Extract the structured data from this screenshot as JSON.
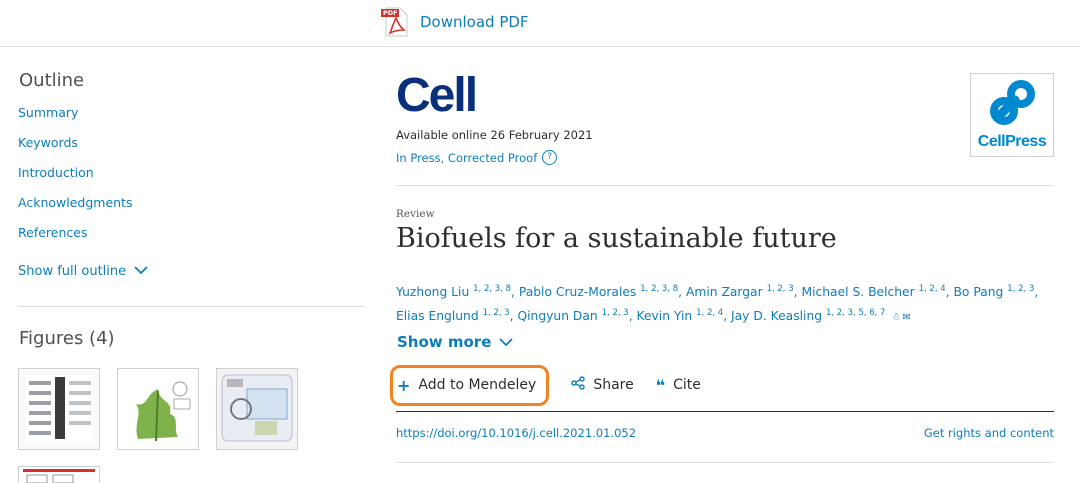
{
  "topbar": {
    "download_pdf": "Download PDF",
    "pdf_badge": "PDF"
  },
  "sidebar": {
    "outline_title": "Outline",
    "outline_items": [
      "Summary",
      "Keywords",
      "Introduction",
      "Acknowledgments",
      "References"
    ],
    "show_full_outline": "Show full outline",
    "figures_title": "Figures (4)"
  },
  "article": {
    "journal": "Cell",
    "available_online": "Available online 26 February 2021",
    "status": "In Press, Corrected Proof",
    "help": "?",
    "publisher_logo": "CellPress",
    "article_type": "Review",
    "title": "Biofuels for a sustainable future",
    "authors": [
      {
        "name": "Yuzhong Liu",
        "aff": "1, 2, 3, 8"
      },
      {
        "name": "Pablo Cruz-Morales",
        "aff": "1, 2, 3, 8"
      },
      {
        "name": "Amin Zargar",
        "aff": "1, 2, 3"
      },
      {
        "name": "Michael S. Belcher",
        "aff": "1, 2, 4"
      },
      {
        "name": "Bo Pang",
        "aff": "1, 2, 3"
      },
      {
        "name": "Elias Englund",
        "aff": "1, 2, 3"
      },
      {
        "name": "Qingyun Dan",
        "aff": "1, 2, 3"
      },
      {
        "name": "Kevin Yin",
        "aff": "1, 2, 4"
      },
      {
        "name": "Jay D. Keasling",
        "aff": "1, 2, 3, 5, 6, 7"
      }
    ],
    "show_more": "Show more",
    "actions": {
      "mendeley": "Add to Mendeley",
      "share": "Share",
      "cite": "Cite"
    },
    "doi": "https://doi.org/10.1016/j.cell.2021.01.052",
    "rights": "Get rights and content"
  },
  "colors": {
    "link": "#0c7dbb",
    "highlight": "#f58220",
    "journal": "#0a2f7c"
  }
}
